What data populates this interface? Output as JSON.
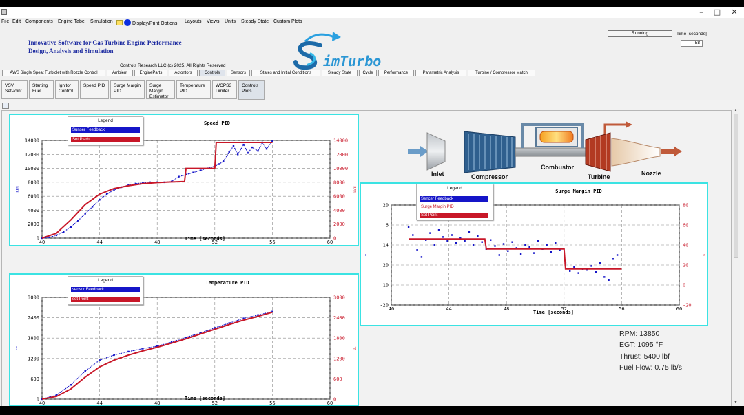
{
  "menubar": [
    "File",
    "Edit",
    "Components",
    "Engine Tabe",
    "Simulation",
    "Display/Print Options",
    "Layouts",
    "Views",
    "Units",
    "Steady State",
    "Custom Plots"
  ],
  "header": {
    "line1": "Innovative Software for Gas Turbine Engine Performance",
    "line2": "Design, Analysis and Simulation",
    "logo_text": "imTurbo",
    "copyright": "Controls Research LLC    (c) 2025,   All Rights Reserved"
  },
  "status": {
    "text": "Running",
    "time_label": "Time [seconds]",
    "time_value": "58"
  },
  "main_tabs": [
    "AWS Single Speat Furbiclet with Rozzle Control",
    "Ambient",
    "EngineParts",
    "Actontors",
    "Controls",
    "Sensors",
    "States and Initial Conditions",
    "Steady State",
    "Cycle",
    "Performance",
    "Parametric Analysis",
    "Turbine / Compressor Match"
  ],
  "active_main_tab": "Controls",
  "sub_tabs": [
    "VSV\nSetPoint",
    "Starting\nFuel",
    "Ignitor\nControl",
    "Speed PID",
    "Surge Margin\nPID",
    "Surge\nMargin\nEstimator",
    "Temperature\nPID",
    "WCPS3\nLimiter",
    "Controls\nPlots"
  ],
  "active_sub_tab": "Controls\nPlots",
  "engine_labels": [
    "Inlet",
    "Compressor",
    "Combustor",
    "Turbine",
    "Nozzle"
  ],
  "stats": [
    "RPM: 13850",
    "EGT: 1095 °F",
    "Thrust: 5400 lbf",
    "Fuel Flow: 0.75 lb/s"
  ],
  "colors": {
    "feedback": "#1515c8",
    "setpoint": "#c81728",
    "panel_border": "#3be3e3"
  },
  "chart_data": [
    {
      "type": "line",
      "title": "Speed PID",
      "xlabel": "Time [seconds]",
      "ylabel_left": "RPM",
      "ylabel_right": "RPM",
      "xlim": [
        40,
        60
      ],
      "ylim": [
        0,
        14000
      ],
      "xticks": [
        40,
        44,
        48,
        52,
        56,
        60
      ],
      "yticks": [
        0,
        2000,
        4000,
        6000,
        8000,
        10000,
        12000,
        14000
      ],
      "legend_title": "Legend",
      "series": [
        {
          "name": "Sunser Feedback",
          "color": "#1515c8",
          "style": "dots",
          "x": [
            40,
            40.5,
            41,
            41.5,
            42,
            42.5,
            43,
            43.5,
            44,
            44.5,
            45,
            45.5,
            46,
            46.5,
            47,
            47.5,
            48,
            48.5,
            49,
            49.5,
            50,
            50.5,
            51,
            51.5,
            52,
            52.3,
            52.6,
            53,
            53.3,
            53.6,
            54,
            54.3,
            54.6,
            55,
            55.3,
            55.6,
            56
          ],
          "y": [
            0,
            100,
            400,
            900,
            1600,
            2500,
            3500,
            4500,
            5500,
            6300,
            6900,
            7300,
            7600,
            7800,
            7900,
            8000,
            8000,
            8000,
            8100,
            8800,
            9100,
            9400,
            9700,
            10000,
            10300,
            10600,
            11000,
            12300,
            13200,
            12000,
            13400,
            12200,
            13000,
            12500,
            13700,
            12800,
            13900
          ]
        },
        {
          "name": "Sot Plarh",
          "color": "#c81728",
          "style": "line",
          "x": [
            40,
            41,
            42,
            43,
            44,
            45,
            46,
            47,
            48,
            49,
            49.9,
            50,
            50.1,
            52,
            52.1,
            56
          ],
          "y": [
            0,
            700,
            2600,
            4800,
            6300,
            7100,
            7500,
            7800,
            7950,
            8050,
            8100,
            10000,
            10000,
            10000,
            13700,
            13700
          ]
        }
      ]
    },
    {
      "type": "line",
      "title": "Temperature PID",
      "xlabel": "Time [seconds]",
      "ylabel_left": "°F",
      "ylabel_right": "°F",
      "xlim": [
        40,
        60
      ],
      "ylim": [
        0,
        3000
      ],
      "xticks": [
        40,
        44,
        48,
        52,
        56,
        60
      ],
      "yticks": [
        0,
        600,
        1200,
        1800,
        2400,
        3000
      ],
      "legend_title": "Legend",
      "series": [
        {
          "name": "seosor Feedback",
          "color": "#1515c8",
          "style": "dots",
          "x": [
            40,
            41,
            42,
            43,
            44,
            45,
            46,
            47,
            48,
            49,
            50,
            51,
            52,
            53,
            54,
            55,
            56
          ],
          "y": [
            0,
            120,
            420,
            830,
            1150,
            1300,
            1400,
            1490,
            1560,
            1680,
            1820,
            1950,
            2100,
            2240,
            2380,
            2480,
            2580
          ]
        },
        {
          "name": "set Point",
          "color": "#c81728",
          "style": "line",
          "x": [
            40,
            41,
            42,
            43,
            44,
            45,
            46,
            47,
            48,
            49,
            50,
            51,
            52,
            53,
            54,
            55,
            56
          ],
          "y": [
            0,
            80,
            300,
            650,
            950,
            1150,
            1300,
            1420,
            1530,
            1650,
            1780,
            1920,
            2060,
            2200,
            2330,
            2440,
            2560
          ]
        }
      ]
    },
    {
      "type": "line",
      "title": "Surge Margin PID",
      "xlabel": "Time [seconds]",
      "ylabel_left": "Y",
      "ylabel_right": "%",
      "xlim": [
        40,
        60
      ],
      "ylim_left": [
        -20,
        20
      ],
      "ylim_right": [
        -20,
        80
      ],
      "xticks": [
        40,
        44,
        48,
        52,
        56,
        60
      ],
      "yticks_left": [
        -20,
        10,
        20,
        14,
        6,
        20
      ],
      "yticks_right": [
        -20,
        0,
        20,
        40,
        60,
        80
      ],
      "legend_title": "Legend",
      "series": [
        {
          "name": "Sencer Feedback",
          "color": "#1515c8",
          "style": "dots",
          "x": [
            41.2,
            41.5,
            41.8,
            42.1,
            42.4,
            42.7,
            43,
            43.3,
            43.6,
            43.9,
            44.2,
            44.5,
            44.8,
            45.1,
            45.4,
            45.7,
            46,
            46.3,
            46.6,
            46.9,
            47.2,
            47.5,
            47.8,
            48.1,
            48.4,
            48.7,
            49,
            49.3,
            49.6,
            49.9,
            50.2,
            50.5,
            50.8,
            51.1,
            51.4,
            51.7,
            52.1,
            52.4,
            52.7,
            53,
            53.3,
            53.6,
            53.9,
            54.2,
            54.5,
            54.8,
            55.1,
            55.4,
            55.7
          ],
          "y": [
            58,
            50,
            35,
            28,
            45,
            52,
            40,
            55,
            48,
            44,
            50,
            42,
            47,
            44,
            53,
            40,
            49,
            43,
            36,
            45,
            39,
            30,
            41,
            34,
            43,
            37,
            31,
            40,
            38,
            32,
            44,
            36,
            40,
            33,
            42,
            35,
            22,
            14,
            18,
            12,
            16,
            15,
            19,
            13,
            22,
            8,
            5,
            26,
            30
          ]
        },
        {
          "name": "Surge Margin PID",
          "color": "#c81728",
          "style": "none",
          "x": [],
          "y": []
        },
        {
          "name": "Set Point",
          "color": "#c81728",
          "style": "line",
          "x": [
            41.2,
            46.5,
            46.6,
            52,
            52.1,
            56
          ],
          "y": [
            46,
            46,
            36,
            36,
            16,
            16
          ]
        }
      ]
    }
  ]
}
